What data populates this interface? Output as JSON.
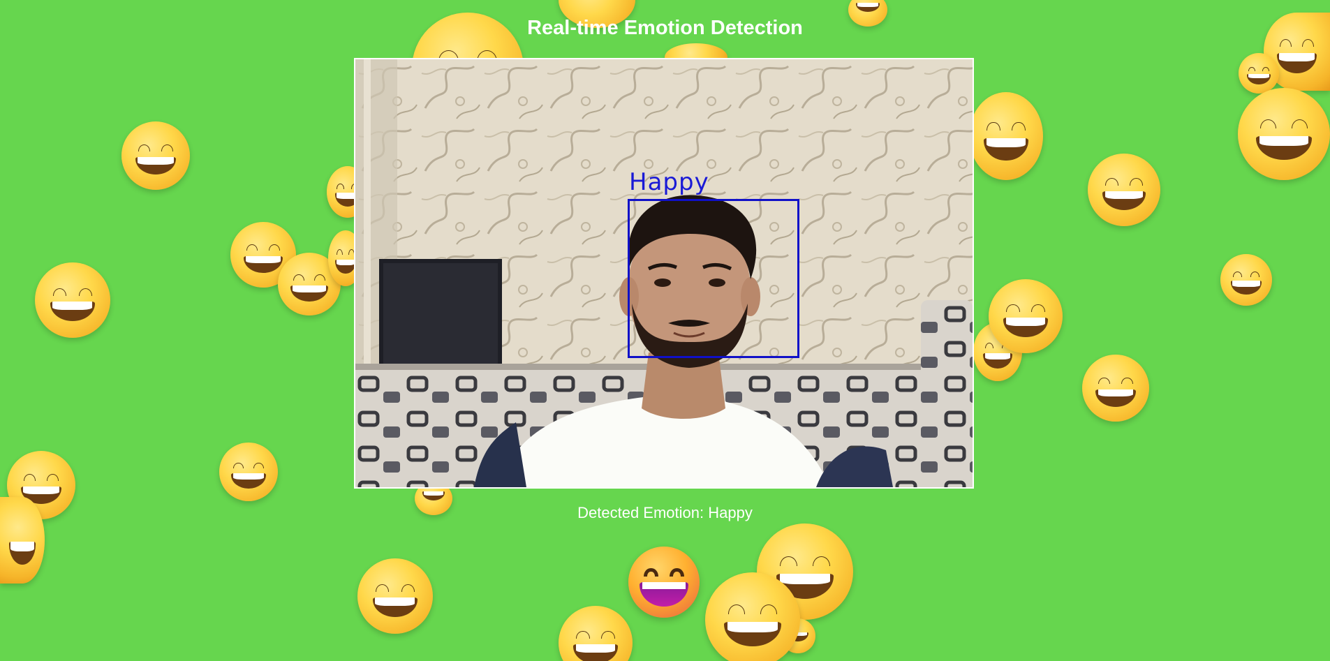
{
  "page": {
    "title": "Real-time Emotion Detection"
  },
  "video": {
    "detection_label": "Happy",
    "box_color": "#1010c8"
  },
  "result": {
    "caption": "Detected Emotion: Happy",
    "emoji_icon": "grinning-face-icon"
  },
  "theme": {
    "background": "#66d64e",
    "text_color": "#ffffff"
  }
}
